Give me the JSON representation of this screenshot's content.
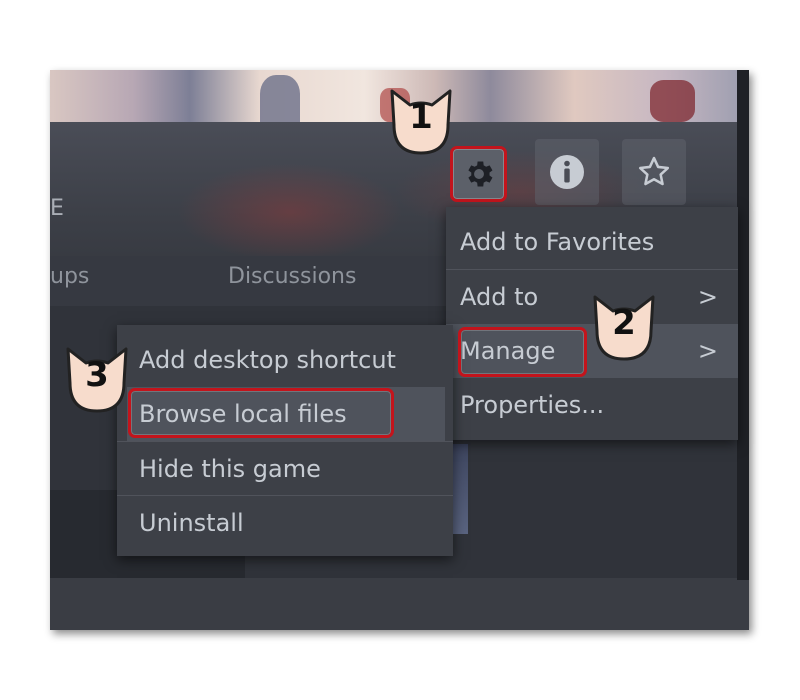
{
  "header": {
    "partial_title_letter": "E"
  },
  "tabs": [
    {
      "label": "ups"
    },
    {
      "label": "Discussions"
    }
  ],
  "toolbar": {
    "icons": [
      "gear-icon",
      "info-icon",
      "star-icon"
    ]
  },
  "context_menu": {
    "items": [
      {
        "label": "Add to Favorites",
        "has_submenu": false
      },
      {
        "label": "Add to",
        "has_submenu": true
      },
      {
        "label": "Manage",
        "has_submenu": true,
        "highlighted": true
      },
      {
        "label": "Properties...",
        "has_submenu": false
      }
    ]
  },
  "submenu": {
    "items": [
      {
        "label": "Add desktop shortcut"
      },
      {
        "label": "Browse local files",
        "highlighted": true
      },
      {
        "label": "Hide this game"
      },
      {
        "label": "Uninstall"
      }
    ]
  },
  "step_badges": [
    "1",
    "2",
    "3"
  ],
  "chevron": ">",
  "colors": {
    "highlight_border": "#c3141c",
    "menu_bg": "#3d4047",
    "menu_text": "#c7ccd3",
    "badge_fill": "#f7dccc"
  }
}
